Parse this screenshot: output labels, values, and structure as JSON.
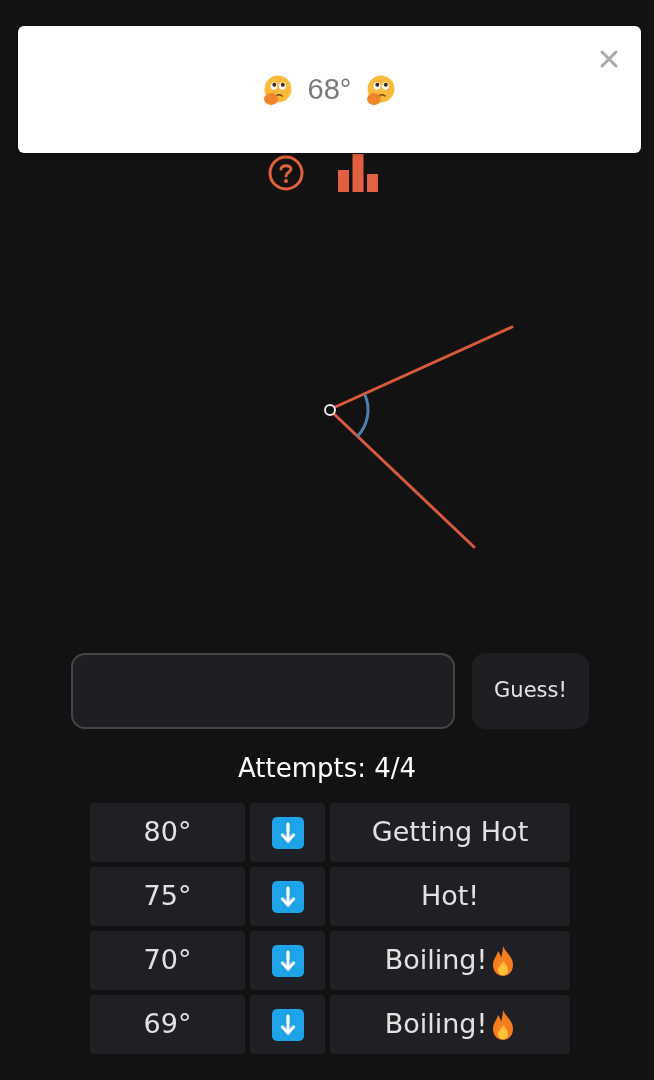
{
  "toast": {
    "answer": "68°"
  },
  "guess_button": "Guess!",
  "attempts": "Attempts: 4/4",
  "guesses": [
    {
      "angle": "80°",
      "go_lower": true,
      "feedback": "Getting Hot",
      "flame": false
    },
    {
      "angle": "75°",
      "go_lower": true,
      "feedback": "Hot!",
      "flame": false
    },
    {
      "angle": "70°",
      "go_lower": true,
      "feedback": "Boiling!",
      "flame": true
    },
    {
      "angle": "69°",
      "go_lower": true,
      "feedback": "Boiling!",
      "flame": true
    }
  ]
}
